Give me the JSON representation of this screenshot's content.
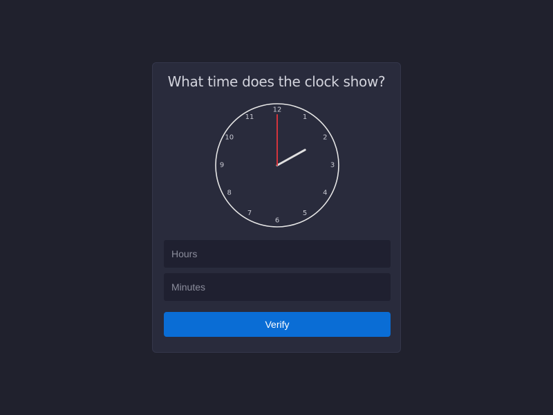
{
  "prompt": {
    "title": "What time does the clock show?"
  },
  "clock": {
    "numerals": [
      "12",
      "1",
      "2",
      "3",
      "4",
      "5",
      "6",
      "7",
      "8",
      "9",
      "10",
      "11"
    ],
    "hour_hand_angle_deg": 61,
    "minute_hand_angle_deg": 0,
    "hour_hand_color": "#e0e0e0",
    "minute_hand_color": "#d4343c"
  },
  "form": {
    "hours_placeholder": "Hours",
    "minutes_placeholder": "Minutes",
    "verify_label": "Verify"
  },
  "colors": {
    "page_background": "#20212d",
    "card_background": "#292b3c",
    "input_background": "#1f2030",
    "button_background": "#0a6dd5"
  }
}
